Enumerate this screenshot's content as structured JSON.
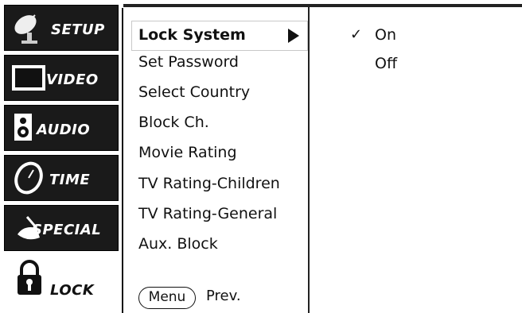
{
  "sidebar": {
    "items": [
      {
        "label": "SETUP",
        "icon": "satellite-dish-icon"
      },
      {
        "label": "VIDEO",
        "icon": "monitor-icon"
      },
      {
        "label": "AUDIO",
        "icon": "speaker-icon"
      },
      {
        "label": "TIME",
        "icon": "clock-icon"
      },
      {
        "label": "SPECIAL",
        "icon": "magic-wand-icon"
      },
      {
        "label": "LOCK",
        "icon": "padlock-icon"
      }
    ],
    "active": "LOCK"
  },
  "menu": {
    "items": [
      "Lock System",
      "Set Password",
      "Select Country",
      "Block Ch.",
      "Movie Rating",
      "TV Rating-Children",
      "TV Rating-General",
      "Aux. Block"
    ],
    "selected": "Lock System"
  },
  "footer": {
    "menu_button": "Menu",
    "prev_label": "Prev."
  },
  "options": {
    "check": "✓",
    "items": [
      "On",
      "Off"
    ],
    "selected": "On"
  }
}
